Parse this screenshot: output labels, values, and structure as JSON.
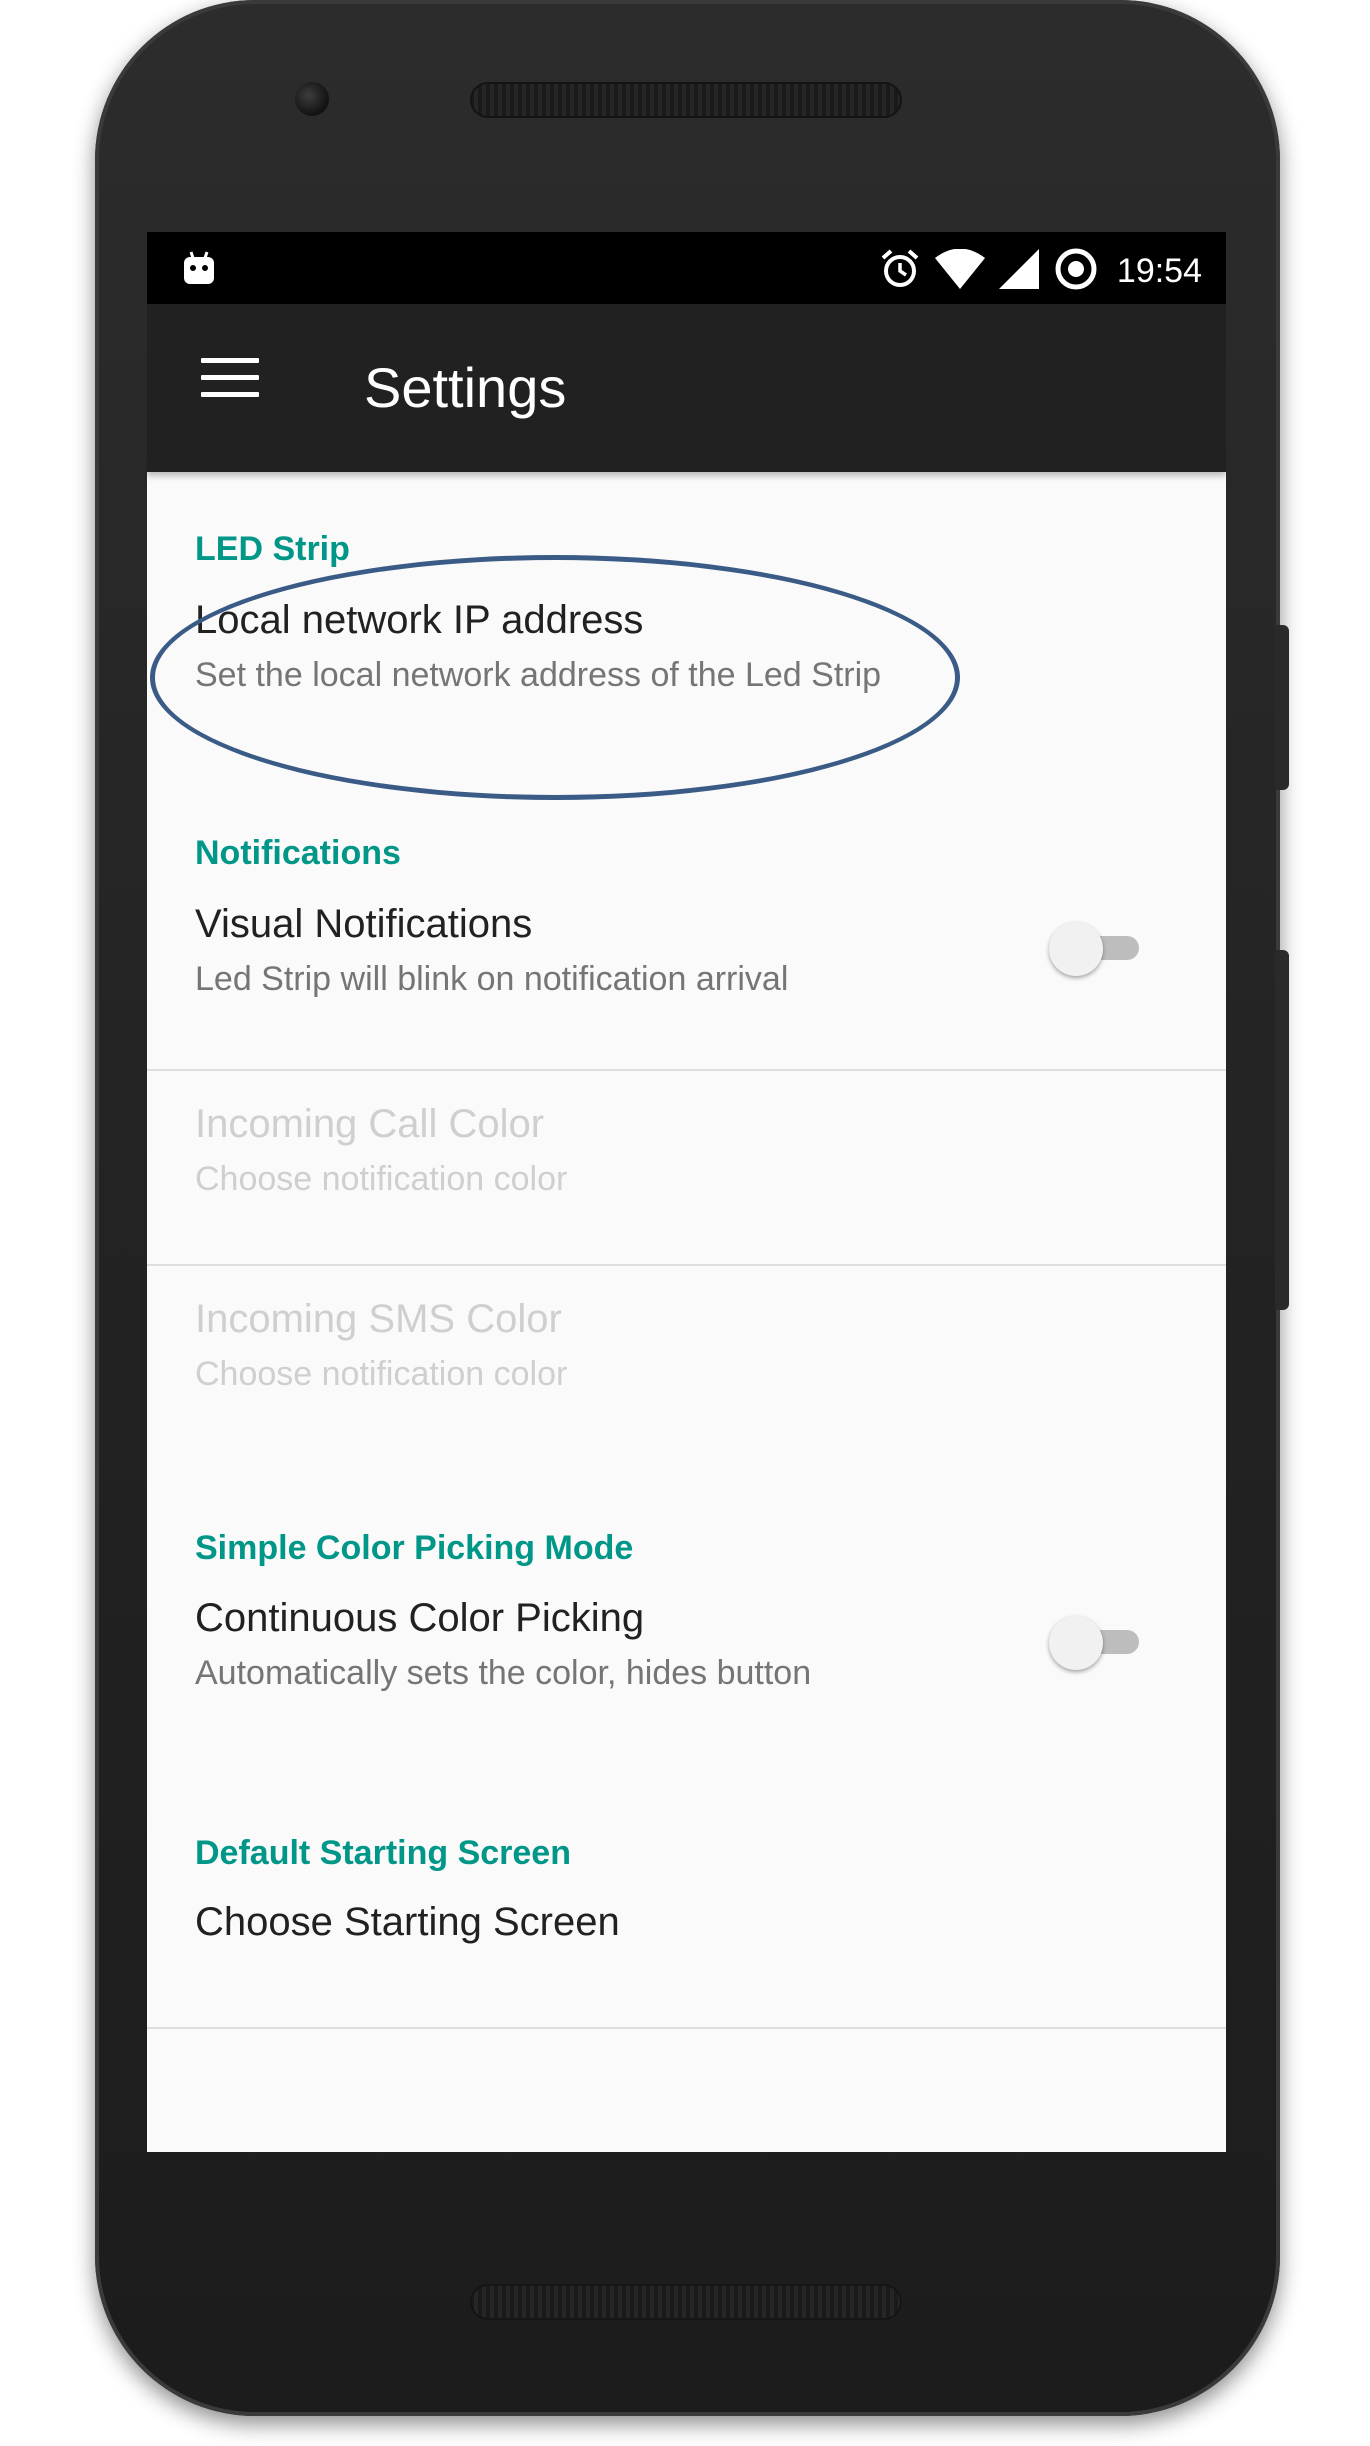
{
  "status_bar": {
    "time": "19:54",
    "icons": [
      "android-notification-icon",
      "alarm-icon",
      "wifi-icon",
      "cell-signal-icon",
      "data-saver-icon"
    ]
  },
  "app_bar": {
    "title": "Settings",
    "menu_icon": "hamburger-menu-icon",
    "background_color": "#212121"
  },
  "accent_color": "#009688",
  "sections": [
    {
      "header": "LED Strip",
      "items": [
        {
          "title": "Local network IP address",
          "summary": "Set the local network address of the Led Strip",
          "enabled": true,
          "highlighted": true
        }
      ]
    },
    {
      "header": "Notifications",
      "items": [
        {
          "title": "Visual Notifications",
          "summary": "Led Strip will blink on notification arrival",
          "enabled": true,
          "switch_on": false
        },
        {
          "title": "Incoming Call Color",
          "summary": "Choose notification color",
          "enabled": false
        },
        {
          "title": "Incoming SMS Color",
          "summary": "Choose notification color",
          "enabled": false
        }
      ]
    },
    {
      "header": "Simple Color Picking Mode",
      "items": [
        {
          "title": "Continuous Color Picking",
          "summary": "Automatically sets the color, hides button",
          "enabled": true,
          "switch_on": false
        }
      ]
    },
    {
      "header": "Default Starting Screen",
      "items": [
        {
          "title": "Choose Starting Screen",
          "enabled": true
        }
      ]
    }
  ],
  "highlight_color": "#3b5b87"
}
